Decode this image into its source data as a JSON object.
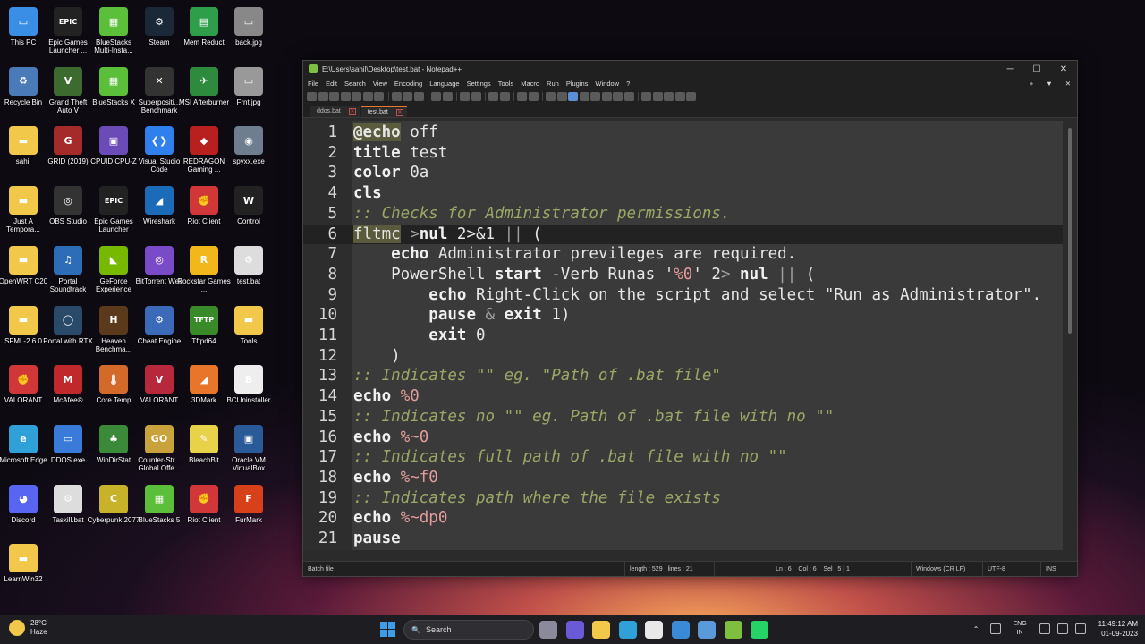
{
  "desktop": {
    "icons": [
      {
        "label": "This PC",
        "color": "#3a8ee6",
        "glyph": "▭"
      },
      {
        "label": "Epic Games Launcher ...",
        "color": "#222222",
        "glyph": "EPIC"
      },
      {
        "label": "BlueStacks Multi-Insta...",
        "color": "#5cbf3a",
        "glyph": "▦"
      },
      {
        "label": "Steam",
        "color": "#1b2838",
        "glyph": "⚙"
      },
      {
        "label": "Mem Reduct",
        "color": "#2e9e4a",
        "glyph": "▤"
      },
      {
        "label": "back.jpg",
        "color": "#888888",
        "glyph": "▭"
      },
      {
        "label": "Recycle Bin",
        "color": "#4a7bb8",
        "glyph": "♻"
      },
      {
        "label": "Grand Theft Auto V",
        "color": "#3d6b2f",
        "glyph": "V"
      },
      {
        "label": "BlueStacks X",
        "color": "#5cbf3a",
        "glyph": "▦"
      },
      {
        "label": "Superpositi... Benchmark",
        "color": "#333333",
        "glyph": "✕"
      },
      {
        "label": "MSI Afterburner",
        "color": "#2e8b3e",
        "glyph": "✈"
      },
      {
        "label": "Frnt.jpg",
        "color": "#999999",
        "glyph": "▭"
      },
      {
        "label": "sahil",
        "color": "#f2c84b",
        "glyph": "▬"
      },
      {
        "label": "GRID (2019)",
        "color": "#a52a2a",
        "glyph": "G"
      },
      {
        "label": "CPUID CPU-Z",
        "color": "#6a4bb8",
        "glyph": "▣"
      },
      {
        "label": "Visual Studio Code",
        "color": "#2f80ed",
        "glyph": "❮❯"
      },
      {
        "label": "REDRAGON Gaming ...",
        "color": "#b82020",
        "glyph": "◆"
      },
      {
        "label": "spyxx.exe",
        "color": "#6e7e8e",
        "glyph": "◉"
      },
      {
        "label": "Just A Tempora...",
        "color": "#f2c84b",
        "glyph": "▬"
      },
      {
        "label": "OBS Studio",
        "color": "#333333",
        "glyph": "◎"
      },
      {
        "label": "Epic Games Launcher",
        "color": "#222222",
        "glyph": "EPIC"
      },
      {
        "label": "Wireshark",
        "color": "#1c6bb8",
        "glyph": "◢"
      },
      {
        "label": "Riot Client",
        "color": "#d13639",
        "glyph": "✊"
      },
      {
        "label": "Control",
        "color": "#222222",
        "glyph": "W"
      },
      {
        "label": "OpenWRT C20",
        "color": "#f2c84b",
        "glyph": "▬"
      },
      {
        "label": "Portal Soundtrack",
        "color": "#2d6db8",
        "glyph": "♫"
      },
      {
        "label": "GeForce Experience",
        "color": "#76b900",
        "glyph": "◣"
      },
      {
        "label": "BitTorrent Web",
        "color": "#7a4bc8",
        "glyph": "◎"
      },
      {
        "label": "Rockstar Games ...",
        "color": "#f2b81b",
        "glyph": "R"
      },
      {
        "label": "test.bat",
        "color": "#dddddd",
        "glyph": "⚙"
      },
      {
        "label": "SFML-2.6.0",
        "color": "#f2c84b",
        "glyph": "▬"
      },
      {
        "label": "Portal with RTX",
        "color": "#2a4a6a",
        "glyph": "◯"
      },
      {
        "label": "Heaven Benchma...",
        "color": "#5a3a1a",
        "glyph": "H"
      },
      {
        "label": "Cheat Engine",
        "color": "#3a6ab8",
        "glyph": "⚙"
      },
      {
        "label": "Tftpd64",
        "color": "#3a8a2a",
        "glyph": "TFTP"
      },
      {
        "label": "Tools",
        "color": "#f2c84b",
        "glyph": "▬"
      },
      {
        "label": "VALORANT",
        "color": "#d13639",
        "glyph": "✊"
      },
      {
        "label": "McAfee®",
        "color": "#c0282c",
        "glyph": "M"
      },
      {
        "label": "Core Temp",
        "color": "#d46a2a",
        "glyph": "🌡"
      },
      {
        "label": "VALORANT",
        "color": "#b8283c",
        "glyph": "V"
      },
      {
        "label": "3DMark",
        "color": "#e8752a",
        "glyph": "◢"
      },
      {
        "label": "BCUninstaller",
        "color": "#eeeeee",
        "glyph": "B"
      },
      {
        "label": "Microsoft Edge",
        "color": "#2fa0d8",
        "glyph": "e"
      },
      {
        "label": "DDOS.exe",
        "color": "#3a7ad8",
        "glyph": "▭"
      },
      {
        "label": "WinDirStat",
        "color": "#3a8a3a",
        "glyph": "♣"
      },
      {
        "label": "Counter-Str... Global Offe...",
        "color": "#c8a23a",
        "glyph": "GO"
      },
      {
        "label": "BleachBit",
        "color": "#e8d24a",
        "glyph": "✎"
      },
      {
        "label": "Oracle VM VirtualBox",
        "color": "#2a5a98",
        "glyph": "▣"
      },
      {
        "label": "Discord",
        "color": "#5865f2",
        "glyph": "◕"
      },
      {
        "label": "Taskill.bat",
        "color": "#dddddd",
        "glyph": "⚙"
      },
      {
        "label": "Cyberpunk 2077",
        "color": "#c8b22a",
        "glyph": "C"
      },
      {
        "label": "BlueStacks 5",
        "color": "#5cbf3a",
        "glyph": "▦"
      },
      {
        "label": "Riot Client",
        "color": "#d13639",
        "glyph": "✊"
      },
      {
        "label": "FurMark",
        "color": "#d8401a",
        "glyph": "F"
      },
      {
        "label": "LearnWin32",
        "color": "#f2c84b",
        "glyph": "▬"
      }
    ]
  },
  "window": {
    "title": "E:\\Users\\sahil\\Desktop\\test.bat - Notepad++",
    "controls": {
      "minimize": "─",
      "maximize": "☐",
      "close": "✕"
    },
    "menu": [
      "File",
      "Edit",
      "Search",
      "View",
      "Encoding",
      "Language",
      "Settings",
      "Tools",
      "Macro",
      "Run",
      "Plugins",
      "Window",
      "?"
    ],
    "menu_right": [
      "+",
      "▼",
      "✕"
    ],
    "tabs": [
      {
        "label": "ddos.bat",
        "active": false
      },
      {
        "label": "test.bat",
        "active": true
      }
    ],
    "tab_close_glyph": "✕"
  },
  "editor": {
    "current_line": 6,
    "lines": [
      {
        "n": "1",
        "parts": [
          {
            "t": "@echo",
            "c": "sel-kw"
          },
          {
            "t": " off",
            "c": "plain"
          }
        ]
      },
      {
        "n": "2",
        "parts": [
          {
            "t": "title",
            "c": "kw"
          },
          {
            "t": " test",
            "c": "plain"
          }
        ]
      },
      {
        "n": "3",
        "parts": [
          {
            "t": "color",
            "c": "kw"
          },
          {
            "t": " 0a",
            "c": "plain"
          }
        ]
      },
      {
        "n": "4",
        "parts": [
          {
            "t": "cls",
            "c": "kw"
          }
        ]
      },
      {
        "n": "5",
        "parts": [
          {
            "t": ":: Checks for Administrator permissions.",
            "c": "cm"
          }
        ]
      },
      {
        "n": "6",
        "parts": [
          {
            "t": "fltmc",
            "c": "sel"
          },
          {
            "t": " >",
            "c": "op"
          },
          {
            "t": "nul",
            "c": "kw"
          },
          {
            "t": " 2>&1 ",
            "c": "plain"
          },
          {
            "t": "||",
            "c": "op"
          },
          {
            "t": " (",
            "c": "plain"
          }
        ]
      },
      {
        "n": "7",
        "parts": [
          {
            "t": "    ",
            "c": "plain"
          },
          {
            "t": "echo",
            "c": "kw"
          },
          {
            "t": " Administrator previleges are required.",
            "c": "plain"
          }
        ]
      },
      {
        "n": "8",
        "parts": [
          {
            "t": "    PowerShell ",
            "c": "plain"
          },
          {
            "t": "start",
            "c": "kw"
          },
          {
            "t": " -Verb Runas '",
            "c": "plain"
          },
          {
            "t": "%0",
            "c": "var"
          },
          {
            "t": "' 2",
            "c": "plain"
          },
          {
            "t": ">",
            "c": "op"
          },
          {
            "t": " ",
            "c": "plain"
          },
          {
            "t": "nul",
            "c": "kw"
          },
          {
            "t": " ",
            "c": "plain"
          },
          {
            "t": "||",
            "c": "op"
          },
          {
            "t": " (",
            "c": "plain"
          }
        ]
      },
      {
        "n": "9",
        "parts": [
          {
            "t": "        ",
            "c": "plain"
          },
          {
            "t": "echo",
            "c": "kw"
          },
          {
            "t": " Right-Click on the script and select \"Run as Administrator\".",
            "c": "plain"
          }
        ]
      },
      {
        "n": "10",
        "parts": [
          {
            "t": "        ",
            "c": "plain"
          },
          {
            "t": "pause",
            "c": "kw"
          },
          {
            "t": " ",
            "c": "plain"
          },
          {
            "t": "&",
            "c": "op"
          },
          {
            "t": " ",
            "c": "plain"
          },
          {
            "t": "exit",
            "c": "kw"
          },
          {
            "t": " 1)",
            "c": "plain"
          }
        ]
      },
      {
        "n": "11",
        "parts": [
          {
            "t": "        ",
            "c": "plain"
          },
          {
            "t": "exit",
            "c": "kw"
          },
          {
            "t": " 0",
            "c": "plain"
          }
        ]
      },
      {
        "n": "12",
        "parts": [
          {
            "t": "    )",
            "c": "plain"
          }
        ]
      },
      {
        "n": "13",
        "parts": [
          {
            "t": ":: Indicates \"\" eg. \"Path of .bat file\"",
            "c": "cm"
          }
        ]
      },
      {
        "n": "14",
        "parts": [
          {
            "t": "echo",
            "c": "kw"
          },
          {
            "t": " ",
            "c": "plain"
          },
          {
            "t": "%0",
            "c": "var"
          }
        ]
      },
      {
        "n": "15",
        "parts": [
          {
            "t": ":: Indicates no \"\" eg. Path of .bat file with no \"\"",
            "c": "cm"
          }
        ]
      },
      {
        "n": "16",
        "parts": [
          {
            "t": "echo",
            "c": "kw"
          },
          {
            "t": " ",
            "c": "plain"
          },
          {
            "t": "%~0",
            "c": "var"
          }
        ]
      },
      {
        "n": "17",
        "parts": [
          {
            "t": ":: Indicates full path of .bat file with no \"\"",
            "c": "cm"
          }
        ]
      },
      {
        "n": "18",
        "parts": [
          {
            "t": "echo",
            "c": "kw"
          },
          {
            "t": " ",
            "c": "plain"
          },
          {
            "t": "%~f0",
            "c": "var"
          }
        ]
      },
      {
        "n": "19",
        "parts": [
          {
            "t": ":: Indicates path where the file exists",
            "c": "cm"
          }
        ]
      },
      {
        "n": "20",
        "parts": [
          {
            "t": "echo",
            "c": "kw"
          },
          {
            "t": " ",
            "c": "plain"
          },
          {
            "t": "%~dp0",
            "c": "var"
          }
        ]
      },
      {
        "n": "21",
        "parts": [
          {
            "t": "pause",
            "c": "kw"
          }
        ]
      }
    ]
  },
  "statusbar": {
    "filetype": "Batch file",
    "length": "length : 529",
    "lines": "lines : 21",
    "position": "Ln : 6    Col : 6    Sel : 5 | 1",
    "eol": "Windows (CR LF)",
    "encoding": "UTF-8",
    "mode": "INS"
  },
  "taskbar": {
    "weather_temp": "28°C",
    "weather_desc": "Haze",
    "search_placeholder": "Search",
    "search_icon": "🔍",
    "language_line1": "ENG",
    "language_line2": "IN",
    "time": "11:49:12 AM",
    "date": "01-09-2023",
    "tray_chevron": "⌃",
    "apps": [
      {
        "name": "task-view-icon",
        "color": "#8a8a9a"
      },
      {
        "name": "chat-icon",
        "color": "#6a5ad8"
      },
      {
        "name": "file-explorer-icon",
        "color": "#f2c84b"
      },
      {
        "name": "edge-icon",
        "color": "#2fa0d8"
      },
      {
        "name": "store-icon",
        "color": "#e8e8e8"
      },
      {
        "name": "mail-icon",
        "color": "#3a8ad8"
      },
      {
        "name": "photos-icon",
        "color": "#5a9ad8"
      },
      {
        "name": "notepad-plus-plus-icon",
        "color": "#7fbf3f"
      },
      {
        "name": "whatsapp-icon",
        "color": "#25d366"
      }
    ]
  }
}
